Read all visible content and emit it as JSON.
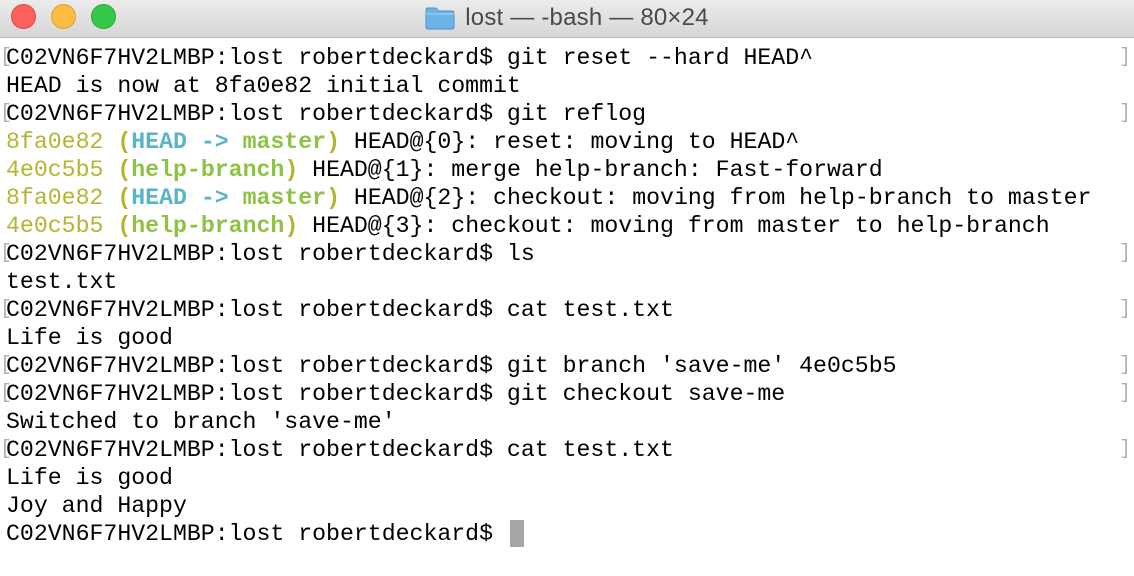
{
  "window": {
    "title": "lost — -bash — 80×24"
  },
  "colors": {
    "hash": "#b5b431",
    "head_ref": "#5ab4c7",
    "branch_ref": "#8ec243",
    "cursor": "#a6a6a6"
  },
  "terminal": {
    "prompt": "C02VN6F7HV2LMBP:lost robertdeckard$",
    "lines": {
      "l1": "C02VN6F7HV2LMBP:lost robertdeckard$ git reset --hard HEAD^",
      "l2": "HEAD is now at 8fa0e82 initial commit",
      "l3": "C02VN6F7HV2LMBP:lost robertdeckard$ git reflog",
      "l8": "C02VN6F7HV2LMBP:lost robertdeckard$ ls",
      "l9": "test.txt",
      "l10": "C02VN6F7HV2LMBP:lost robertdeckard$ cat test.txt",
      "l11": "Life is good",
      "l12": "C02VN6F7HV2LMBP:lost robertdeckard$ git branch 'save-me' 4e0c5b5",
      "l13": "C02VN6F7HV2LMBP:lost robertdeckard$ git checkout save-me",
      "l14": "Switched to branch 'save-me'",
      "l15": "C02VN6F7HV2LMBP:lost robertdeckard$ cat test.txt",
      "l16": "Life is good",
      "l17": "Joy and Happy",
      "l18": "C02VN6F7HV2LMBP:lost robertdeckard$ "
    },
    "reflog": [
      {
        "hash": "8fa0e82",
        "open": " (",
        "head": "HEAD -> ",
        "branch": "master",
        "close": ")",
        "rest": " HEAD@{0}: reset: moving to HEAD^"
      },
      {
        "hash": "4e0c5b5",
        "open": " (",
        "branch": "help-branch",
        "close": ")",
        "rest": " HEAD@{1}: merge help-branch: Fast-forward"
      },
      {
        "hash": "8fa0e82",
        "open": " (",
        "head": "HEAD -> ",
        "branch": "master",
        "close": ")",
        "rest": " HEAD@{2}: checkout: moving from help-branch to master"
      },
      {
        "hash": "4e0c5b5",
        "open": " (",
        "branch": "help-branch",
        "close": ")",
        "rest": " HEAD@{3}: checkout: moving from master to help-branch"
      }
    ]
  }
}
